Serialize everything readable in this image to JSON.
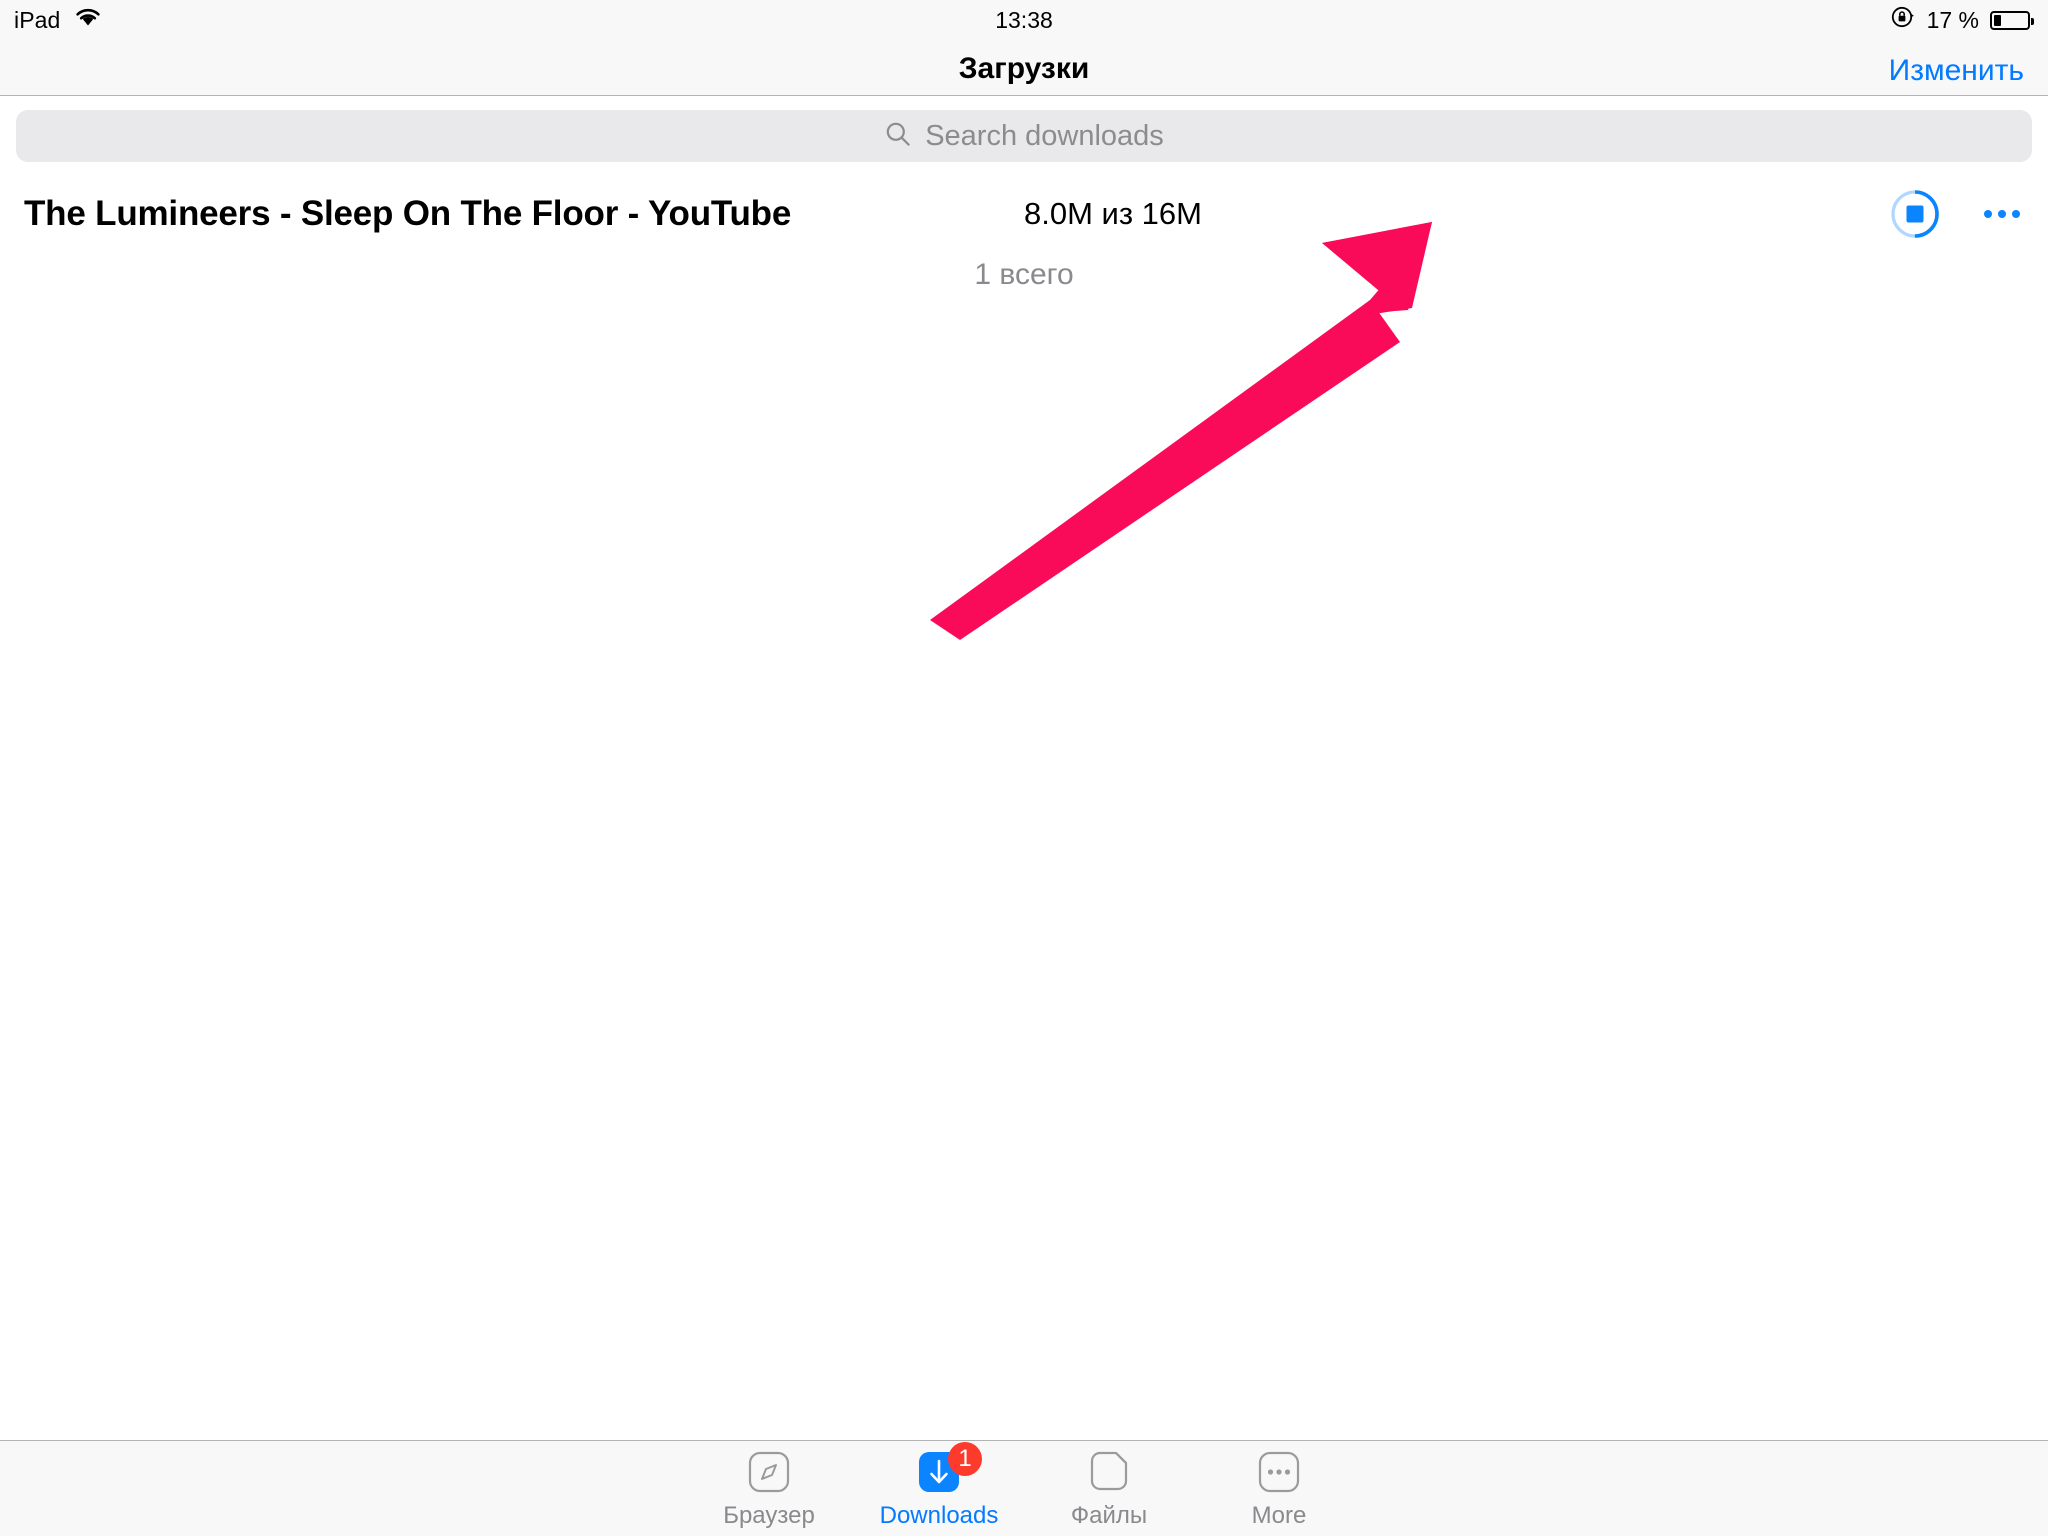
{
  "status_bar": {
    "device": "iPad",
    "wifi_icon": "wifi-icon",
    "time": "13:38",
    "rotation_lock_icon": "rotation-lock-icon",
    "battery_percent": "17 %",
    "battery_icon": "battery-icon"
  },
  "nav_bar": {
    "title": "Загрузки",
    "edit_label": "Изменить",
    "accent_color": "#037aff"
  },
  "search": {
    "placeholder": "Search downloads",
    "value": "",
    "icon": "search-icon"
  },
  "downloads": {
    "items": [
      {
        "title": "The Lumineers - Sleep On The Floor - YouTube",
        "size": "8.0M из 16M",
        "progress_percent": 50,
        "stop_icon": "stop-icon",
        "more_icon": "ellipsis-icon",
        "progress_color": "#0a84ff"
      }
    ],
    "total_label": "1 всего"
  },
  "annotation": {
    "arrow_icon": "arrow-pointer-annotation",
    "color": "#fa0b5a"
  },
  "tab_bar": {
    "items": [
      {
        "label": "Браузер",
        "icon": "compass-icon",
        "active": false,
        "badge": ""
      },
      {
        "label": "Downloads",
        "icon": "download-arrow-icon",
        "active": true,
        "badge": "1"
      },
      {
        "label": "Файлы",
        "icon": "document-icon",
        "active": false,
        "badge": ""
      },
      {
        "label": "More",
        "icon": "ellipsis-box-icon",
        "active": false,
        "badge": ""
      }
    ],
    "active_color": "#037aff",
    "inactive_color": "#8a8a8e",
    "badge_color": "#fc3b2d"
  }
}
